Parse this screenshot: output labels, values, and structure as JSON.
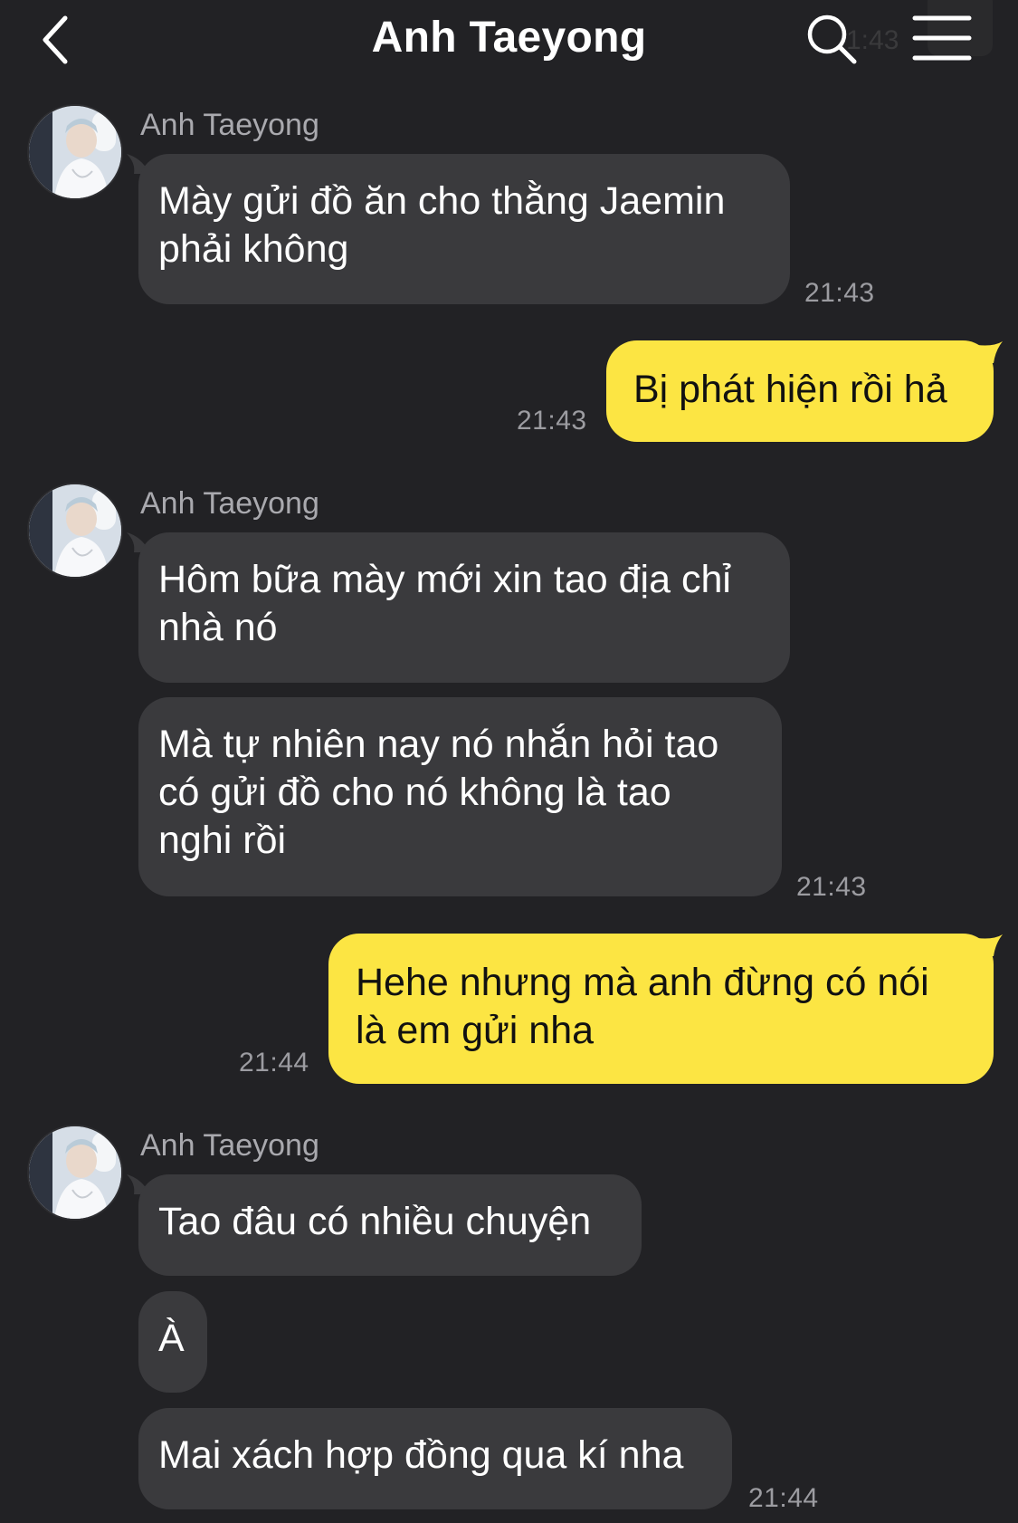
{
  "header": {
    "title": "Anh Taeyong",
    "ghost_time": "1:43"
  },
  "colors": {
    "background": "#222225",
    "incoming_bubble": "#3a3a3d",
    "outgoing_bubble": "#fce543",
    "timestamp": "#9c9ca1",
    "sender_name": "#a9a9ae"
  },
  "icons": {
    "back": "chevron-left-icon",
    "search": "search-icon",
    "menu": "hamburger-menu-icon"
  },
  "messages": [
    {
      "direction": "in",
      "sender": "Anh Taeyong",
      "text": "Mày gửi đồ ăn cho thằng Jaemin\nphải không",
      "time": "21:43"
    },
    {
      "direction": "out",
      "text": "Bị phát hiện rồi hả",
      "time": "21:43"
    },
    {
      "direction": "in",
      "sender": "Anh Taeyong",
      "text": "Hôm bữa mày mới xin tao địa chỉ\nnhà nó"
    },
    {
      "direction": "in",
      "text": "Mà tự nhiên nay nó nhắn hỏi tao\ncó gửi đồ cho nó không là tao\nnghi rồi",
      "time": "21:43"
    },
    {
      "direction": "out",
      "text": "Hehe nhưng mà anh đừng có nói\nlà em gửi nha",
      "time": "21:44"
    },
    {
      "direction": "in",
      "sender": "Anh Taeyong",
      "text": "Tao đâu có nhiều chuyện"
    },
    {
      "direction": "in",
      "text": "À"
    },
    {
      "direction": "in",
      "text": "Mai xách hợp đồng qua kí nha",
      "time": "21:44"
    }
  ]
}
